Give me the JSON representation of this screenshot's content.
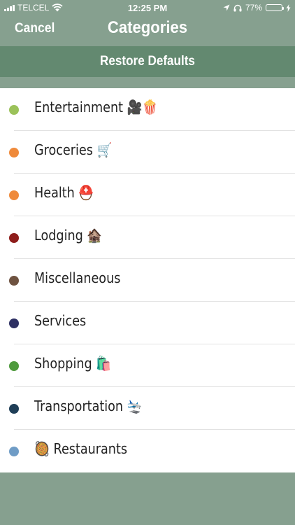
{
  "status": {
    "carrier": "TELCEL",
    "time": "12:25 PM",
    "battery": "77%",
    "battery_level": 0.77
  },
  "nav": {
    "cancel": "Cancel",
    "title": "Categories"
  },
  "restore": {
    "label": "Restore Defaults"
  },
  "categories": [
    {
      "label": "Entertainment 🎥🍿",
      "color": "#9bc25a"
    },
    {
      "label": "Groceries 🛒",
      "color": "#ef8a3b"
    },
    {
      "label": "Health ⛑️",
      "color": "#ef8a3b"
    },
    {
      "label": "Lodging 🏚️",
      "color": "#8e1d1b"
    },
    {
      "label": "Miscellaneous",
      "color": "#6e5240"
    },
    {
      "label": "Services",
      "color": "#2e3063"
    },
    {
      "label": "Shopping 🛍️",
      "color": "#4f9a3d"
    },
    {
      "label": "Transportation 🛬",
      "color": "#1f3e57"
    },
    {
      "label": "🥘 Restaurants",
      "color": "#6f9cc6"
    }
  ],
  "colors": {
    "nav_bg": "#86a08f",
    "restore_bg": "#638970",
    "list_bg": "#ffffff",
    "separator": "#e2e2e2"
  }
}
